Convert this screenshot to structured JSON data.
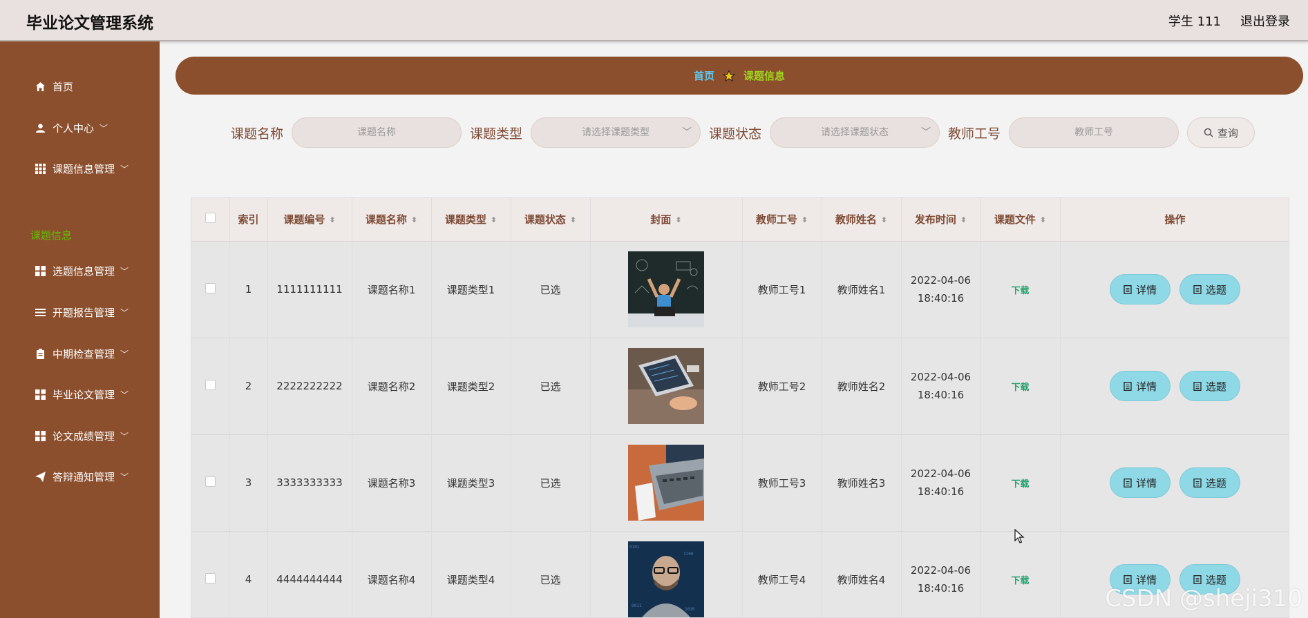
{
  "header": {
    "title": "毕业论文管理系统",
    "user": "学生 111",
    "logout": "退出登录"
  },
  "sidebar": {
    "items": [
      {
        "label": "首页",
        "icon": "home-icon",
        "chevron": false
      },
      {
        "label": "个人中心",
        "icon": "user-icon",
        "chevron": true
      },
      {
        "label": "课题信息管理",
        "icon": "grid-icon",
        "chevron": true
      },
      {
        "label": "选题信息管理",
        "icon": "apps-icon",
        "chevron": true
      },
      {
        "label": "开题报告管理",
        "icon": "list-icon",
        "chevron": true
      },
      {
        "label": "中期检查管理",
        "icon": "clipboard-icon",
        "chevron": true
      },
      {
        "label": "毕业论文管理",
        "icon": "apps-icon",
        "chevron": true
      },
      {
        "label": "论文成绩管理",
        "icon": "apps-icon",
        "chevron": true
      },
      {
        "label": "答辩通知管理",
        "icon": "send-icon",
        "chevron": true
      }
    ],
    "active_sub": "课题信息"
  },
  "breadcrumb": {
    "home": "首页",
    "current": "课题信息"
  },
  "search": {
    "name_label": "课题名称",
    "name_placeholder": "课题名称",
    "type_label": "课题类型",
    "type_placeholder": "请选择课题类型",
    "status_label": "课题状态",
    "status_placeholder": "请选择课题状态",
    "teacher_label": "教师工号",
    "teacher_placeholder": "教师工号",
    "query_button": "查询"
  },
  "table": {
    "headers": [
      "索引",
      "课题编号",
      "课题名称",
      "课题类型",
      "课题状态",
      "封面",
      "教师工号",
      "教师姓名",
      "发布时间",
      "课题文件",
      "操作"
    ],
    "rows": [
      {
        "index": "1",
        "code": "1111111111",
        "name": "课题名称1",
        "type": "课题类型1",
        "status": "已选",
        "teacher_id": "教师工号1",
        "teacher_name": "教师姓名1",
        "date": "2022-04-06",
        "time": "18:40:16",
        "file": "下载"
      },
      {
        "index": "2",
        "code": "2222222222",
        "name": "课题名称2",
        "type": "课题类型2",
        "status": "已选",
        "teacher_id": "教师工号2",
        "teacher_name": "教师姓名2",
        "date": "2022-04-06",
        "time": "18:40:16",
        "file": "下载"
      },
      {
        "index": "3",
        "code": "3333333333",
        "name": "课题名称3",
        "type": "课题类型3",
        "status": "已选",
        "teacher_id": "教师工号3",
        "teacher_name": "教师姓名3",
        "date": "2022-04-06",
        "time": "18:40:16",
        "file": "下载"
      },
      {
        "index": "4",
        "code": "4444444444",
        "name": "课题名称4",
        "type": "课题类型4",
        "status": "已选",
        "teacher_id": "教师工号4",
        "teacher_name": "教师姓名4",
        "date": "2022-04-06",
        "time": "18:40:16",
        "file": "下载"
      }
    ],
    "detail_button": "详情",
    "select_button": "选题"
  },
  "watermark": "CSDN @sheji310",
  "colors": {
    "sidebar": "#8b4f2d",
    "header": "#e9e1df",
    "accent_blue": "#5ec8ee",
    "accent_green": "#9fd31e",
    "button": "#8fd8e6",
    "download": "#2aa070"
  }
}
